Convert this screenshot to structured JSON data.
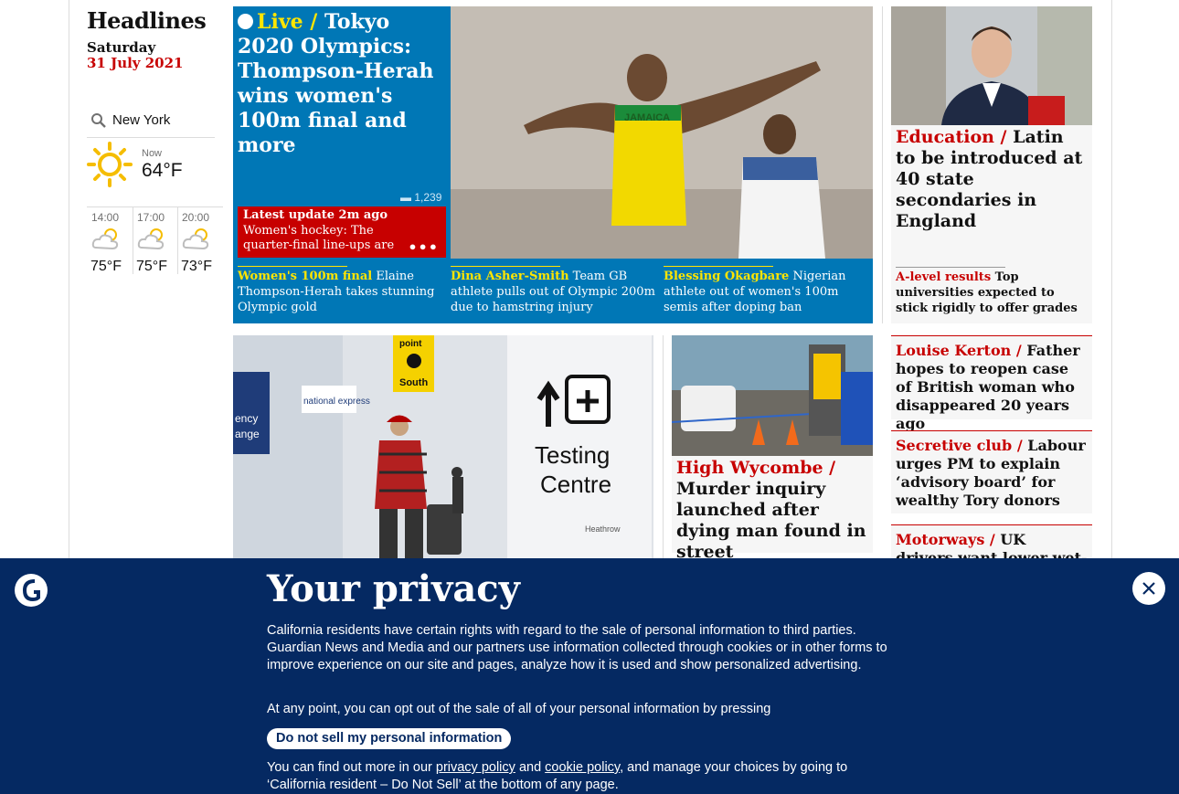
{
  "sidebar": {
    "title": "Headlines",
    "day": "Saturday",
    "date": "31 July 2021",
    "weather": {
      "location": "New York",
      "now_label": "Now",
      "now_temp": "64°F",
      "forecast": [
        {
          "time": "14:00",
          "temp": "75°F"
        },
        {
          "time": "17:00",
          "temp": "75°F"
        },
        {
          "time": "20:00",
          "temp": "73°F"
        }
      ]
    }
  },
  "top_story": {
    "kicker": "Live /",
    "headline": "Tokyo 2020 Olympics: Thompson-Herah wins women's 100m final and more",
    "comment_count": "1,239",
    "update_label": "Latest update 2m ago",
    "update_text": "Women's hockey: The quarter-final line-ups are complete after",
    "image_text": "JAMAICA",
    "sublinks": [
      {
        "kicker": "Women's 100m final",
        "text": "Elaine Thompson-Herah takes stunning Olympic gold"
      },
      {
        "kicker": "Dina Asher-Smith",
        "text": "Team GB athlete pulls out of Olympic 200m due to hamstring injury"
      },
      {
        "kicker": "Blessing Okagbare",
        "text": "Nigerian athlete out of women's 100m semis after doping ban"
      }
    ]
  },
  "second_story": {
    "signs": [
      "point",
      "South",
      "Testing",
      "Centre",
      "Heathrow",
      "national express",
      "ency",
      "ange"
    ]
  },
  "third_story": {
    "kicker": "High Wycombe /",
    "headline": "Murder inquiry launched after dying man found in street"
  },
  "right_column": {
    "kicker": "Education /",
    "headline": "Latin to be introduced at 40 state secondaries in England",
    "sub_kicker": "A-level results",
    "sub_text": "Top universities expected to stick rigidly to offer grades",
    "cards": [
      {
        "kicker": "Louise Kerton /",
        "headline": "Father hopes to reopen case of British woman who disappeared 20 years ago"
      },
      {
        "kicker": "Secretive club /",
        "headline": "Labour urges PM to explain ‘advisory board’ for wealthy Tory donors"
      },
      {
        "kicker": "Motorways /",
        "headline": "UK drivers want lower wet-weather"
      }
    ]
  },
  "privacy": {
    "title": "Your privacy",
    "para1": "California residents have certain rights with regard to the sale of personal information to third parties. Guardian News and Media and our partners use information collected through cookies or in other forms to improve experience on our site and pages, analyze how it is used and show personalized advertising.",
    "para2": "At any point, you can opt out of the sale of all of your personal information by pressing",
    "button": "Do not sell my personal information",
    "para3_start": "You can find out more in our",
    "privacy_link": "privacy policy",
    "and": "and",
    "cookie_link": "cookie policy",
    "para3_end": ", and manage your choices by going to ‘California resident – Do Not Sell’ at the bottom of any page."
  },
  "colors": {
    "news_red": "#c70000",
    "live_blue": "#0077b6",
    "guardian_navy": "#052962",
    "live_yellow": "#ffe500"
  }
}
